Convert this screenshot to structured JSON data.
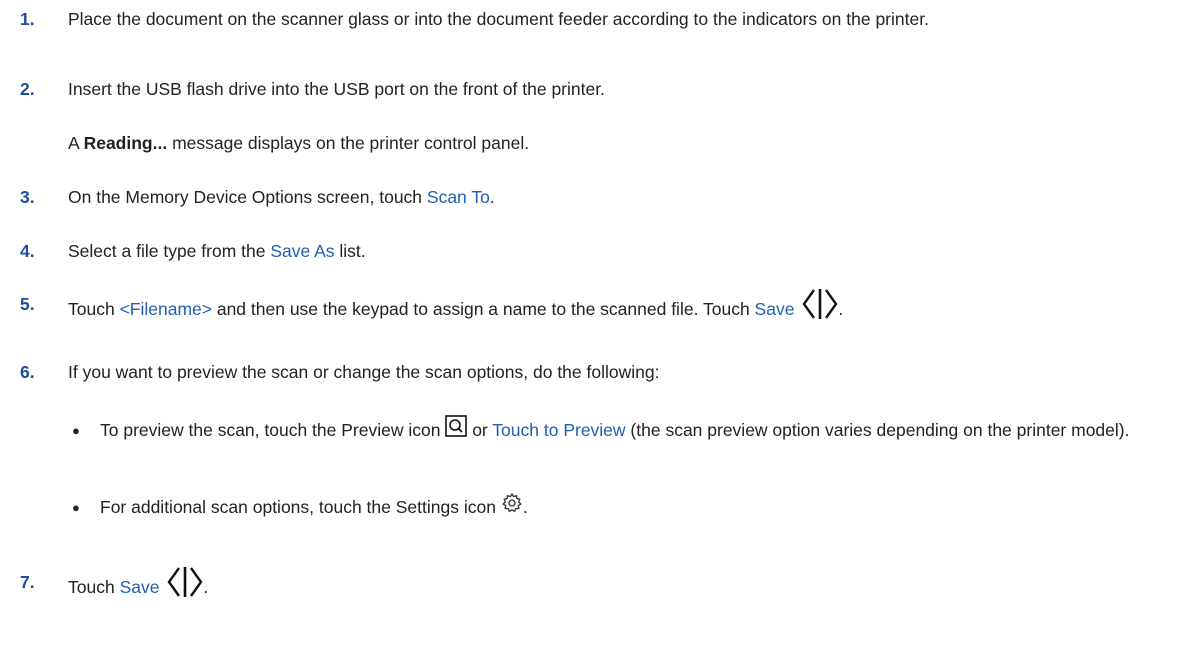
{
  "steps": [
    {
      "number": "1.",
      "text": "Place the document on the scanner glass or into the document feeder according to the indicators on the printer."
    },
    {
      "number": "2.",
      "text": "Insert the USB flash drive into the USB port on the front of the printer.",
      "sub_prefix": "A ",
      "sub_bold": "Reading...",
      "sub_suffix": " message displays on the printer control panel."
    },
    {
      "number": "3.",
      "text_before": "On the Memory Device Options screen, touch ",
      "link": "Scan To",
      "text_after": "."
    },
    {
      "number": "4.",
      "text_before": "Select a file type from the ",
      "link": "Save As",
      "text_after": " list."
    },
    {
      "number": "5.",
      "text_before": "Touch ",
      "link1": "<Filename>",
      "text_middle": " and then use the keypad to assign a name to the scanned file. Touch ",
      "link2": "Save",
      "text_after": "."
    },
    {
      "number": "6.",
      "text": "If you want to preview the scan or change the scan options, do the following:",
      "bullets": [
        {
          "text_before": "To preview the scan, touch the Preview icon ",
          "icon": "preview-magnifier-icon",
          "text_middle": " or ",
          "link": "Touch to Preview",
          "text_after": " (the scan preview option varies depending on the printer model)."
        },
        {
          "text_before": "For additional scan options, touch the Settings icon ",
          "icon": "settings-gear-icon",
          "text_after": "."
        }
      ]
    },
    {
      "number": "7.",
      "text_before": "Touch ",
      "link": "Save",
      "text_after": "."
    }
  ],
  "bullet_glyph": "●",
  "colors": {
    "step_number": "#1f4d99",
    "link": "#1f5fb0",
    "body_text": "#222222"
  }
}
